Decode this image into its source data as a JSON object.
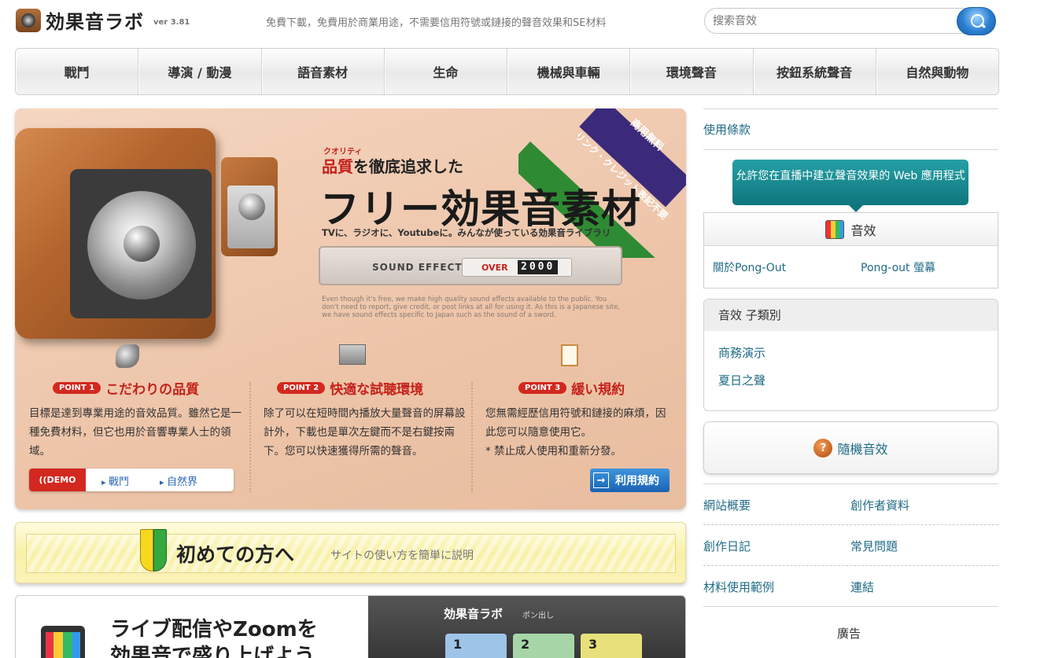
{
  "header": {
    "logo_text": "効果音ラボ",
    "version": "ver 3.81",
    "tagline": "免費下載，免費用於商業用途，不需要信用符號或鏈接的聲音效果和SE材料",
    "search_placeholder": "搜索音效"
  },
  "nav": [
    "戰鬥",
    "導演 / 動漫",
    "語音素材",
    "生命",
    "機械與車輛",
    "環境聲音",
    "按鈕系統聲音",
    "自然與動物"
  ],
  "hero": {
    "ribbon_top": "商用無料",
    "ribbon_bottom": "リンク・クレジット表記不要",
    "quality_small": "クオリティ",
    "subtitle_em": "品質",
    "subtitle_rest": "を徹底追求した",
    "title": "フリー効果音素材",
    "tv_line": "TVに、ラジオに、Youtubeに。みんなが使っている効果音ライブラリ",
    "se_label": "SOUND EFFECTS",
    "se_over": "OVER",
    "se_number": "2000",
    "english": "Even though it's free, we make high quality sound effects available to the public. You don't need to report, give credit, or post links at all for using it. As this is a Japanese site, we have sound effects specific to Japan such as the sound of a sword.",
    "points": [
      {
        "badge": "POINT 1",
        "title": "こだわりの品質",
        "text": "目標是達到專業用途的音效品質。雖然它是一種免費材料，但它也用於音響專業人士的領域。"
      },
      {
        "badge": "POINT 2",
        "title": "快適な試聴環境",
        "text": "除了可以在短時間內播放大量聲音的屏幕設計外，下載也是單次左鍵而不是右鍵按兩下。您可以快速獲得所需的聲音。"
      },
      {
        "badge": "POINT 3",
        "title": "緩い規約",
        "text": "您無需經歷信用符號和鏈接的麻煩，因此您可以隨意使用它。\n* 禁止成人使用和重新分發。"
      }
    ],
    "demo_tag": "((DEMO",
    "demo_links": [
      "戰鬥",
      "自然界"
    ],
    "rules_button": "利用規約"
  },
  "beginner": {
    "title": "初めての方へ",
    "desc": "サイトの使い方を簡単に説明"
  },
  "live": {
    "title_line1": "ライブ配信やZoomを",
    "title_line2": "効果音で盛り上げよう",
    "panel_logo": "効果音ラボ",
    "panel_sub": "ポン出し",
    "keys": [
      "1",
      "2",
      "3"
    ],
    "key_colors": [
      "#9ec4e8",
      "#a6d6a8",
      "#e8e07a"
    ]
  },
  "sidebar": {
    "terms": "使用條款",
    "tooltip": "允許您在直播中建立聲音效果的 Web 應用程式",
    "se_title": "音效",
    "about_pongout": "關於Pong-Out",
    "pongout_screen": "Pong-out 螢幕",
    "sub_title": "音效 子類別",
    "sub_items": [
      "商務演示",
      "夏日之聲"
    ],
    "random": "隨機音效",
    "random_icon": "?",
    "links": [
      [
        "網站概要",
        "創作者資料"
      ],
      [
        "創作日記",
        "常見問題"
      ],
      [
        "材料使用範例",
        "連結"
      ]
    ],
    "ad": "廣告"
  }
}
